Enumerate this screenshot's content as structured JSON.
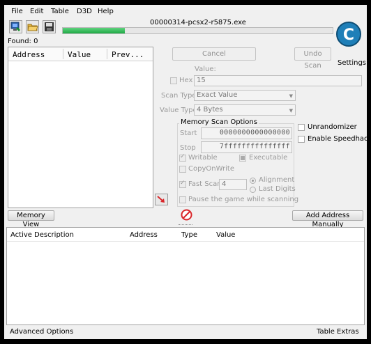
{
  "menu": [
    "File",
    "Edit",
    "Table",
    "D3D",
    "Help"
  ],
  "process_title": "00000314-pcsx2-r5875.exe",
  "progress": 0.23,
  "found": "Found: 0",
  "scan_list": {
    "headers": [
      "Address",
      "Value",
      "Prev..."
    ]
  },
  "buttons": {
    "cancel": "Cancel",
    "undo_scan": "Undo Scan",
    "settings": "Settings",
    "memory_view": "Memory View",
    "add_address": "Add Address Manually",
    "advanced_options": "Advanced Options",
    "table_extras": "Table Extras"
  },
  "value_label": "Value:",
  "hex_label": "Hex",
  "value_input": "15",
  "scan_type": {
    "label": "Scan Type",
    "selected": "Exact Value"
  },
  "value_type": {
    "label": "Value Type",
    "selected": "4 Bytes"
  },
  "memory_scan": {
    "title": "Memory Scan Options",
    "start_label": "Start",
    "start_value": "0000000000000000",
    "stop_label": "Stop",
    "stop_value": "7fffffffffffffff",
    "writable": "Writable",
    "executable": "Executable",
    "copy_on_write": "CopyOnWrite",
    "fast_scan": "Fast Scan",
    "fast_scan_value": "4",
    "alignment": "Alignment",
    "last_digits": "Last Digits",
    "pause_game": "Pause the game while scanning"
  },
  "unrandomizer": "Unrandomizer",
  "enable_speedhack": "Enable Speedhack",
  "address_table": {
    "headers": [
      "Active",
      "Description",
      "Address",
      "Type",
      "Value"
    ]
  },
  "colors": {
    "progress": "#22b14c",
    "accent": "#1b6f9f",
    "cancel_red": "#d9262a"
  }
}
